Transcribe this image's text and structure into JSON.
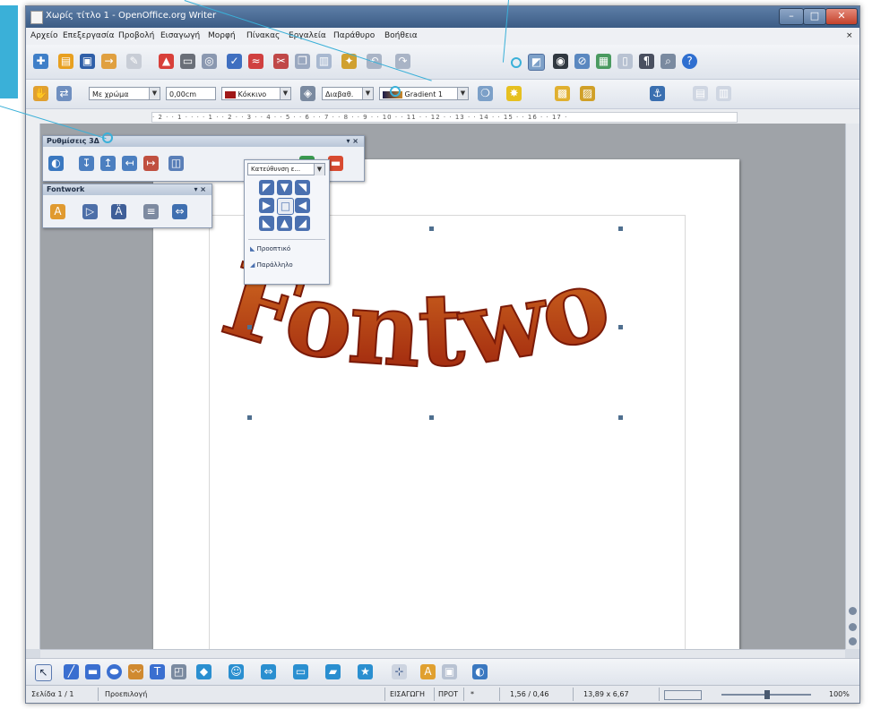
{
  "window": {
    "title": "Χωρίς τίτλο 1 - OpenOffice.org Writer",
    "min": "–",
    "max": "□",
    "close": "✕"
  },
  "menu": [
    "Αρχείο",
    "Επεξεργασία",
    "Προβολή",
    "Εισαγωγή",
    "Μορφή",
    "Πίνακας",
    "Εργαλεία",
    "Παράθυρο",
    "Βοήθεια"
  ],
  "menu_close": "×",
  "format_bar": {
    "line_style": "Με χρώμα",
    "line_width": "0,00cm",
    "line_color": "Κόκκινο",
    "fill_type": "Διαβαθ.",
    "fill_name": "Gradient 1"
  },
  "ruler_text": "· 2 · · 1 · · · · 1 · · 2 · · 3 · · 4 · · 5 · · 6 · · 7 · · 8 · · 9 · · 10 · · 11 · · 12 · · 13 · · 14 · · 15 · · 16 · · 17 ·",
  "panels": {
    "settings": {
      "title": "Ρυθμίσεις 3Δ",
      "controls": "▾ ×"
    },
    "fontwork": {
      "title": "Fontwork",
      "controls": "▾ ×"
    },
    "extrusion": {
      "title": "Κατεύθυνση ε...",
      "perspective": "Προοπτικό",
      "parallel": "Παράλληλο"
    }
  },
  "document": {
    "fontwork_text": "Fontwork"
  },
  "status": {
    "page": "Σελίδα 1 / 1",
    "style": "Προεπιλογή",
    "insert": "ΕΙΣΑΓΩΓΗ",
    "selmode": "ΠΡΟΤ",
    "star": "*",
    "position": "1,56 / 0,46",
    "size": "13,89 x 6,67",
    "zoom": "100%"
  },
  "colors": {
    "accent": "#3ab0d8",
    "wordart_dark": "#9a1f0c",
    "wordart_light": "#f2c860"
  }
}
